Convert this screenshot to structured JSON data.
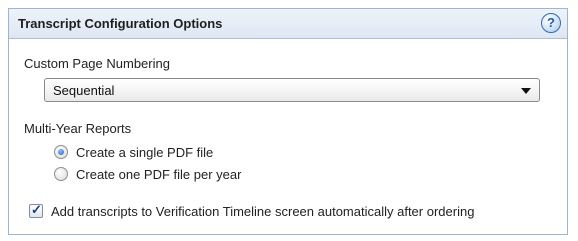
{
  "panel": {
    "title": "Transcript Configuration Options",
    "help_glyph": "?"
  },
  "page_numbering": {
    "label": "Custom Page Numbering",
    "selected": "Sequential"
  },
  "multi_year": {
    "label": "Multi-Year Reports",
    "options": [
      {
        "label": "Create a single PDF file",
        "selected": true
      },
      {
        "label": "Create one PDF file per year",
        "selected": false
      }
    ]
  },
  "auto_add": {
    "label": "Add transcripts to Verification Timeline screen automatically after ordering",
    "checked": true,
    "check_glyph": "✓"
  }
}
